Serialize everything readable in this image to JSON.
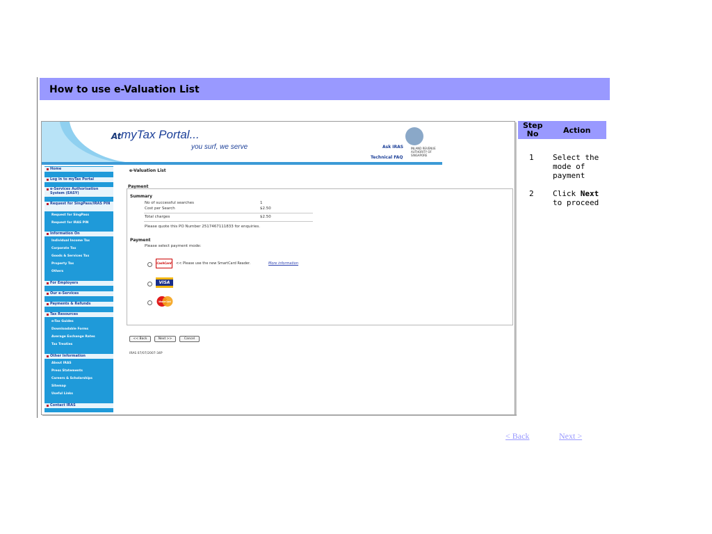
{
  "title": "How to use e-Valuation List",
  "portal": {
    "at": "At",
    "name": "myTax Portal...",
    "tagline": "you surf, we serve",
    "ask_iras": "Ask IRAS",
    "technical_faq": "Technical FAQ",
    "iras_name": "INLAND REVENUE AUTHORITY OF SINGAPORE"
  },
  "sidebar": {
    "home": "Home",
    "login": "Log in to myTax Portal",
    "easy": "e-Services Authorisation System (EASY)",
    "request_pin": "Request for SingPass/IRAS PIN",
    "request_pin_items": [
      "Request for SingPass",
      "Request for IRAS PIN"
    ],
    "information_on": "Information On",
    "information_items": [
      "Individual Income Tax",
      "Corporate Tax",
      "Goods & Services Tax",
      "Property Tax",
      "Others"
    ],
    "for_employers": "For Employers",
    "our_eservices": "Our e-Services",
    "payments_refunds": "Payments & Refunds",
    "tax_resources": "Tax Resources",
    "tax_resources_items": [
      "e-Tax Guides",
      "Downloadable Forms",
      "Average Exchange Rates",
      "Tax Treaties"
    ],
    "other_information": "Other Information",
    "other_items": [
      "About IRAS",
      "Press Statements",
      "Careers & Scholarships",
      "Sitemap",
      "Useful Links"
    ],
    "contact": "Contact IRAS"
  },
  "content": {
    "page_heading": "e-Valuation List",
    "section_payment": "Payment",
    "summary_heading": "Summary",
    "rows": [
      {
        "label": "No of successful searches",
        "value": "1"
      },
      {
        "label": "Cost per Search",
        "value": "$2.50"
      },
      {
        "label": "Total charges",
        "value": "$2.50"
      }
    ],
    "po_note": "Please quote this PO Number 2517467111833 for enquiries.",
    "payment_heading": "Payment",
    "select_mode": "Please select payment mode:",
    "cashcard_note": "<< Please use the new SmartCard Reader.",
    "more_info": "More information",
    "cashcard_label": "CashCard",
    "visa_label": "VISA",
    "mastercard_label": "MasterCard",
    "buttons": {
      "back": "<< Back",
      "next": "Next >>",
      "cancel": "Cancel"
    },
    "footer_code": "IRAS 07/07/2007-34P"
  },
  "steps": {
    "col_step": "Step No",
    "col_action": "Action",
    "rows": [
      {
        "no": "1",
        "action_lines": [
          "Select the",
          "mode of",
          "payment"
        ]
      },
      {
        "no": "2",
        "action_pre": "Click ",
        "action_bold": "Next",
        "action_post": "to proceed"
      }
    ]
  },
  "nav": {
    "back": "< Back",
    "next": "Next >"
  },
  "colors": {
    "accent": "#9999ff",
    "sidebar": "#1f9ad9",
    "portal_blue": "#1b3f98"
  }
}
